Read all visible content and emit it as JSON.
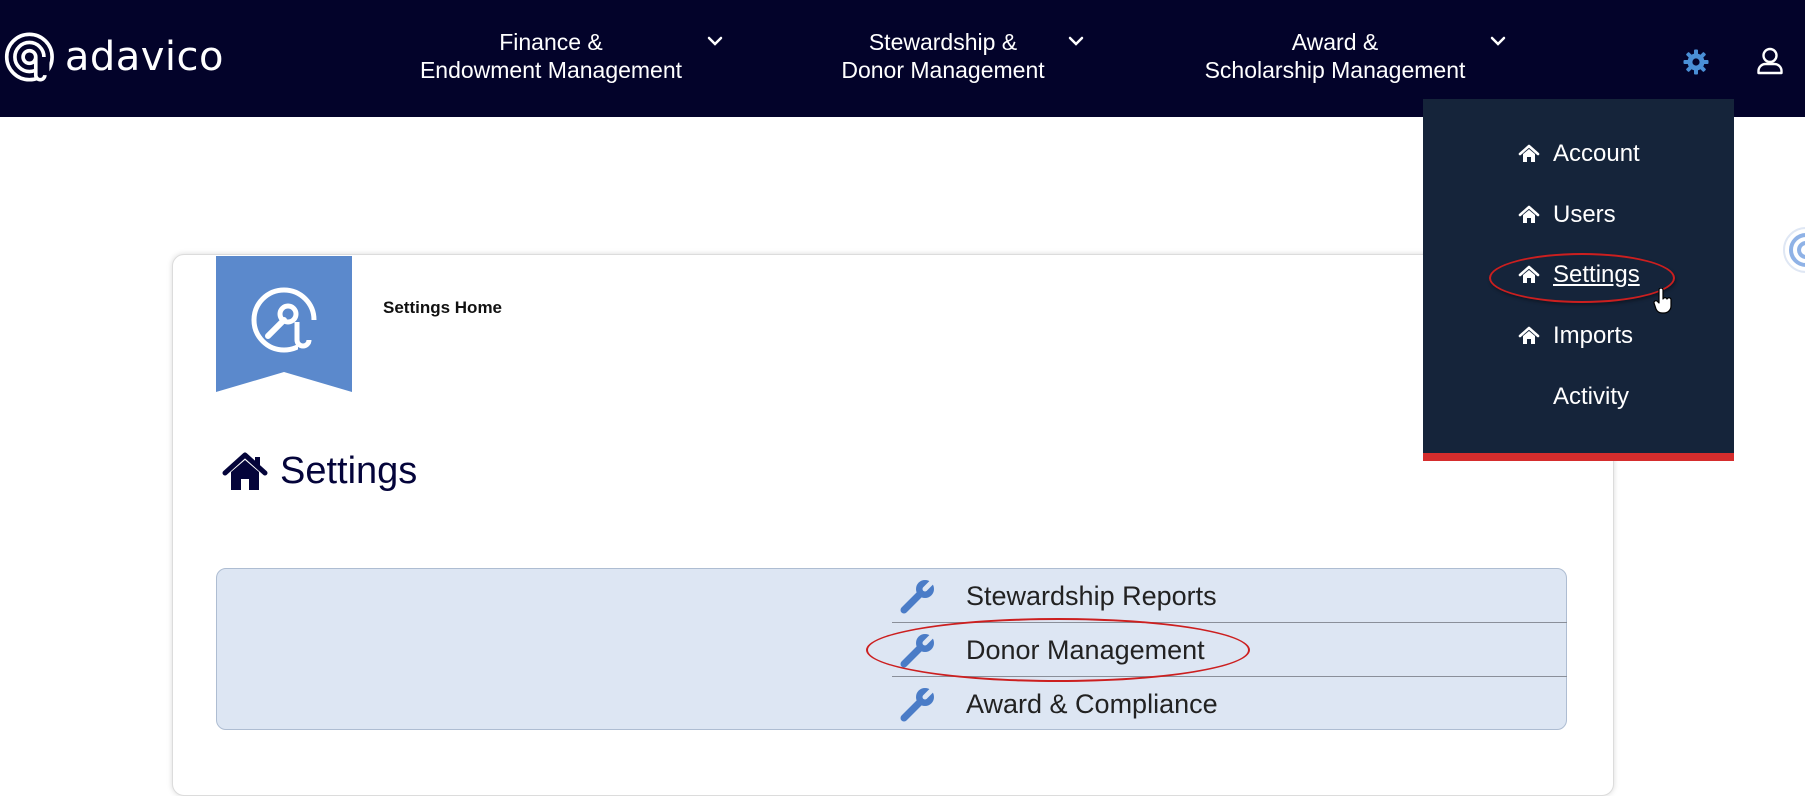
{
  "brand": {
    "name": "adavico"
  },
  "nav": {
    "items": [
      {
        "line1": "Finance &",
        "line2": "Endowment Management"
      },
      {
        "line1": "Stewardship &",
        "line2": "Donor Management"
      },
      {
        "line1": "Award &",
        "line2": "Scholarship Management"
      }
    ],
    "icons": {
      "settings": "gear-icon",
      "user": "user-icon",
      "expand": "chevron-down-icon"
    }
  },
  "dropdown": {
    "items": [
      {
        "label": "Account",
        "icon": "home-icon"
      },
      {
        "label": "Users",
        "icon": "home-icon"
      },
      {
        "label": "Settings",
        "icon": "home-icon",
        "active": true
      },
      {
        "label": "Imports",
        "icon": "home-icon"
      },
      {
        "label": "Activity"
      }
    ],
    "colors": {
      "background": "#15243a",
      "accent_bar": "#d52d2d"
    }
  },
  "breadcrumb": {
    "label": "Settings Home"
  },
  "page": {
    "title": "Settings"
  },
  "settings_links": [
    {
      "label": "Stewardship Reports",
      "icon": "wrench-icon"
    },
    {
      "label": "Donor Management",
      "icon": "wrench-icon"
    },
    {
      "label": "Award & Compliance",
      "icon": "wrench-icon"
    }
  ],
  "colors": {
    "nav_background": "#03032a",
    "ribbon": "#5b89cc",
    "panel_background": "#dde6f3",
    "annotation": "#cc1f1f",
    "wrench": "#4a7cc7",
    "title": "#04043a"
  }
}
